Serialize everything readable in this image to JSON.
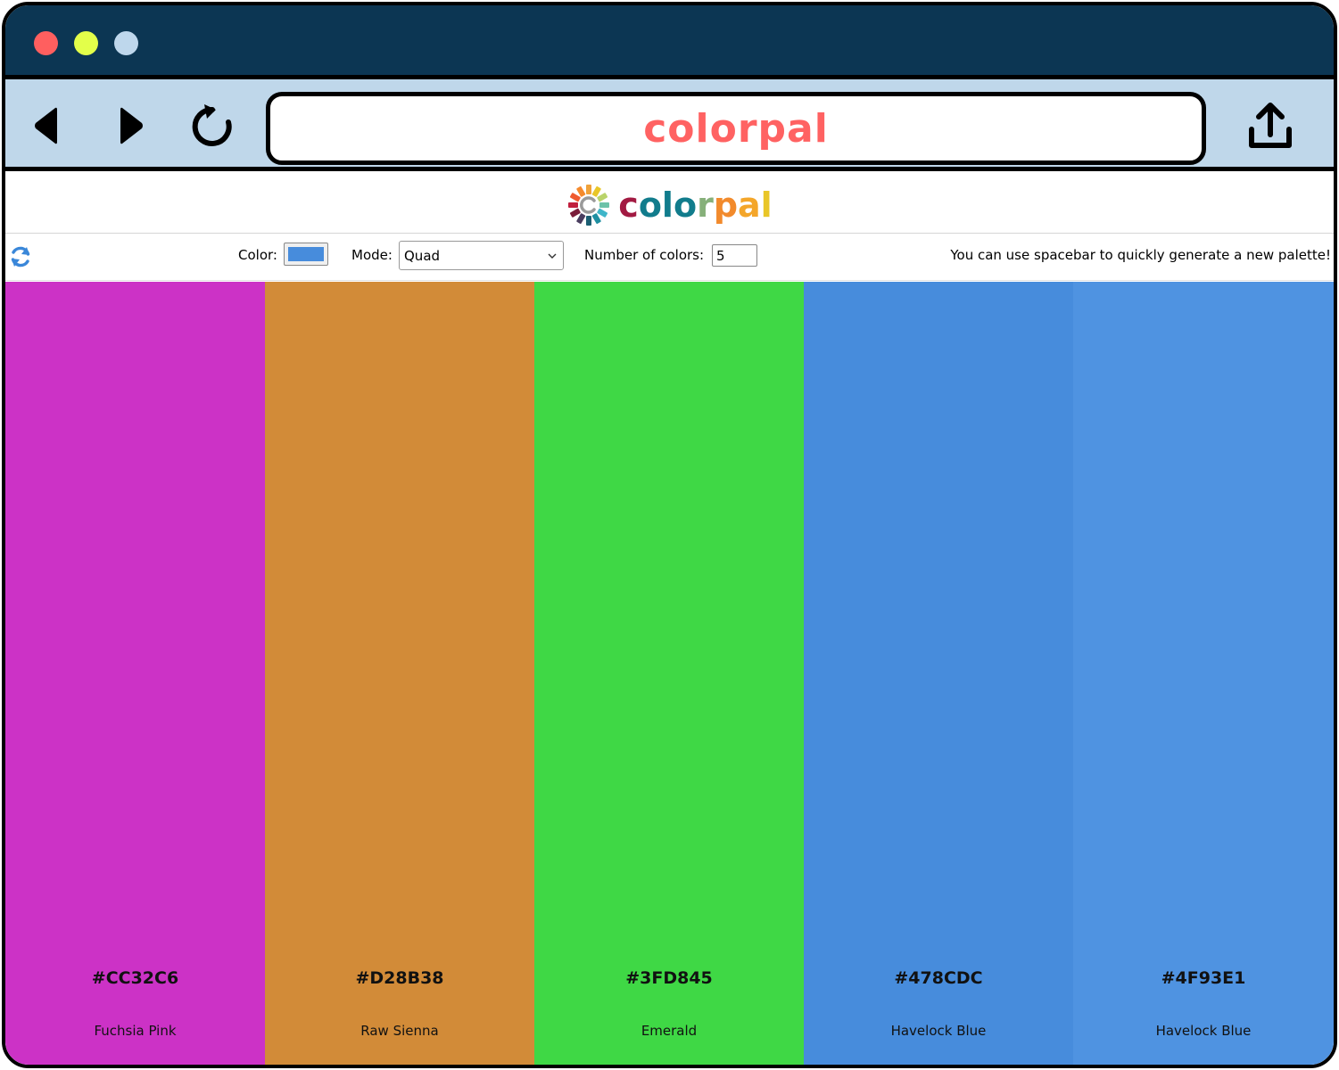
{
  "browser": {
    "traffic_lights": {
      "red": "#ff5f5f",
      "yellow": "#e3ff4a",
      "blue": "#bed7ec"
    },
    "title_bar_color": "#0c3653",
    "nav_bar_color": "#bfd7ea",
    "url_text": "colorpal",
    "url_text_color": "#ff6262",
    "icons": [
      "back-arrow-icon",
      "forward-arrow-icon",
      "reload-icon",
      "share-icon"
    ]
  },
  "app": {
    "logo": {
      "letters": [
        "c",
        "o",
        "l",
        "o",
        "r",
        "p",
        "a",
        "l"
      ],
      "letter_colors": [
        "#a21a42",
        "#117c8c",
        "#117c8c",
        "#117c8c",
        "#86b07a",
        "#f28a2c",
        "#f4a62a",
        "#e9c628"
      ]
    },
    "controls": {
      "color_label": "Color:",
      "color_value": "#478CDC",
      "mode_label": "Mode:",
      "mode_value": "Quad",
      "num_label": "Number of colors:",
      "num_value": "5",
      "hint": "You can use spacebar to quickly generate a new palette!",
      "refresh_icon_color": "#3a87d9"
    },
    "palette": [
      {
        "hex": "#CC32C6",
        "name": "Fuchsia Pink"
      },
      {
        "hex": "#D28B38",
        "name": "Raw Sienna"
      },
      {
        "hex": "#3FD845",
        "name": "Emerald"
      },
      {
        "hex": "#478CDC",
        "name": "Havelock Blue"
      },
      {
        "hex": "#4F93E1",
        "name": "Havelock Blue"
      }
    ]
  }
}
